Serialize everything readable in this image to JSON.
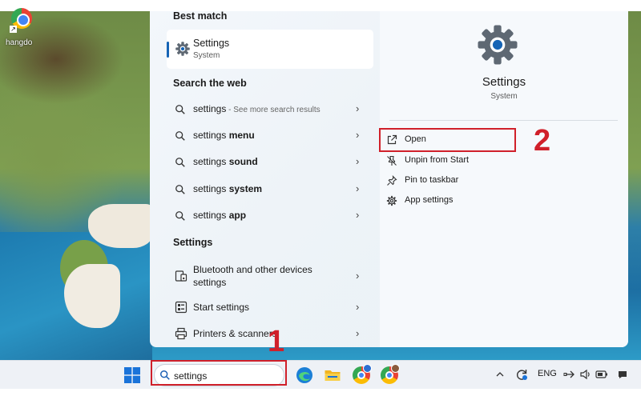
{
  "desktop": {
    "icon_label": "hangdo"
  },
  "search_panel": {
    "best_match": {
      "heading": "Best match",
      "title": "Settings",
      "subtitle": "System"
    },
    "web": {
      "heading": "Search the web",
      "rows": [
        {
          "query": "settings",
          "suffix": " - See more search results"
        },
        {
          "query": "settings ",
          "bold": "menu"
        },
        {
          "query": "settings ",
          "bold": "sound"
        },
        {
          "query": "settings ",
          "bold": "system"
        },
        {
          "query": "settings ",
          "bold": "app"
        }
      ]
    },
    "settings_section": {
      "heading": "Settings",
      "rows": [
        {
          "label": "Bluetooth and other devices settings",
          "icon": "devices-icon"
        },
        {
          "label": "Start settings",
          "icon": "start-menu-icon"
        },
        {
          "label": "Printers & scanners",
          "icon": "printer-icon"
        }
      ]
    },
    "detail": {
      "title": "Settings",
      "subtitle": "System",
      "actions": [
        {
          "label": "Open",
          "icon": "open-external-icon"
        },
        {
          "label": "Unpin from Start",
          "icon": "unpin-icon"
        },
        {
          "label": "Pin to taskbar",
          "icon": "pin-icon"
        },
        {
          "label": "App settings",
          "icon": "gear-icon"
        }
      ]
    }
  },
  "annotations": {
    "step1": "1",
    "step2": "2",
    "color": "#d0202a"
  },
  "taskbar": {
    "search_value": "settings",
    "language": "ENG",
    "icons": [
      "windows-start-icon",
      "edge-icon",
      "file-explorer-icon",
      "chrome-profile-icon",
      "chrome-icon"
    ],
    "tray_icons": [
      "chevron-up-icon",
      "sync-icon",
      "network-icon",
      "volume-icon",
      "battery-icon"
    ]
  },
  "colors": {
    "accent": "#1664b5",
    "gear": "#5e6873"
  }
}
